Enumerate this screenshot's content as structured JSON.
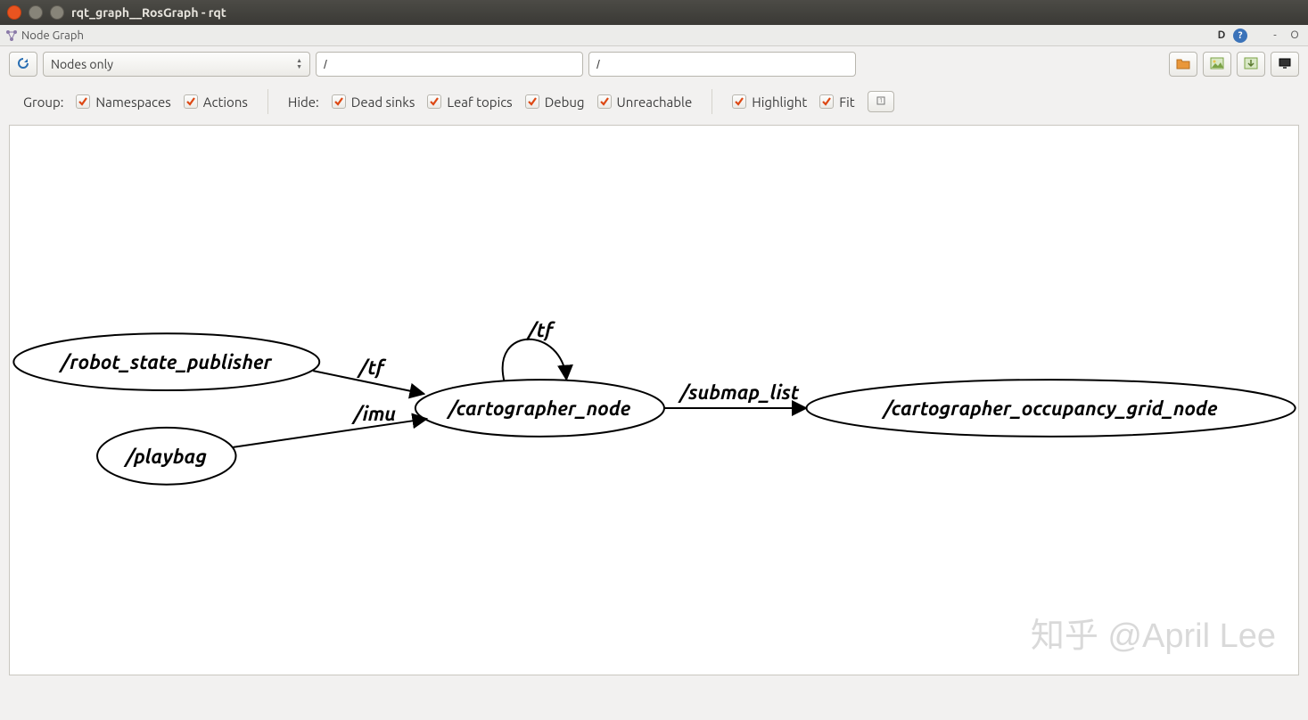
{
  "window": {
    "title": "rqt_graph__RosGraph - rqt"
  },
  "dock": {
    "title": "Node Graph",
    "dperspective_label": "D",
    "help_label": "?",
    "min_label": "-",
    "float_label": "O"
  },
  "toolbar": {
    "refresh_tooltip": "Reload graph",
    "combo_selected": "Nodes only",
    "filter1_value": "/",
    "filter2_value": "/",
    "btn_folder": "folder-icon",
    "btn_save": "save-image-icon",
    "btn_load": "load-dot-icon",
    "btn_view": "view-icon"
  },
  "options": {
    "group_label": "Group:",
    "namespaces": "Namespaces",
    "actions": "Actions",
    "hide_label": "Hide:",
    "dead_sinks": "Dead sinks",
    "leaf_topics": "Leaf topics",
    "debug": "Debug",
    "unreachable": "Unreachable",
    "highlight": "Highlight",
    "fit": "Fit",
    "zoom_tooltip": "zoom"
  },
  "graph": {
    "nodes": {
      "robot_state_publisher": "/robot_state_publisher",
      "playbag": "/playbag",
      "cartographer_node": "/cartographer_node",
      "cartographer_occupancy_grid_node": "/cartographer_occupancy_grid_node"
    },
    "edges": {
      "tf_rsp": "/tf",
      "imu": "/imu",
      "tf_self": "/tf",
      "submap_list": "/submap_list"
    }
  },
  "watermark": "知乎 @April Lee"
}
